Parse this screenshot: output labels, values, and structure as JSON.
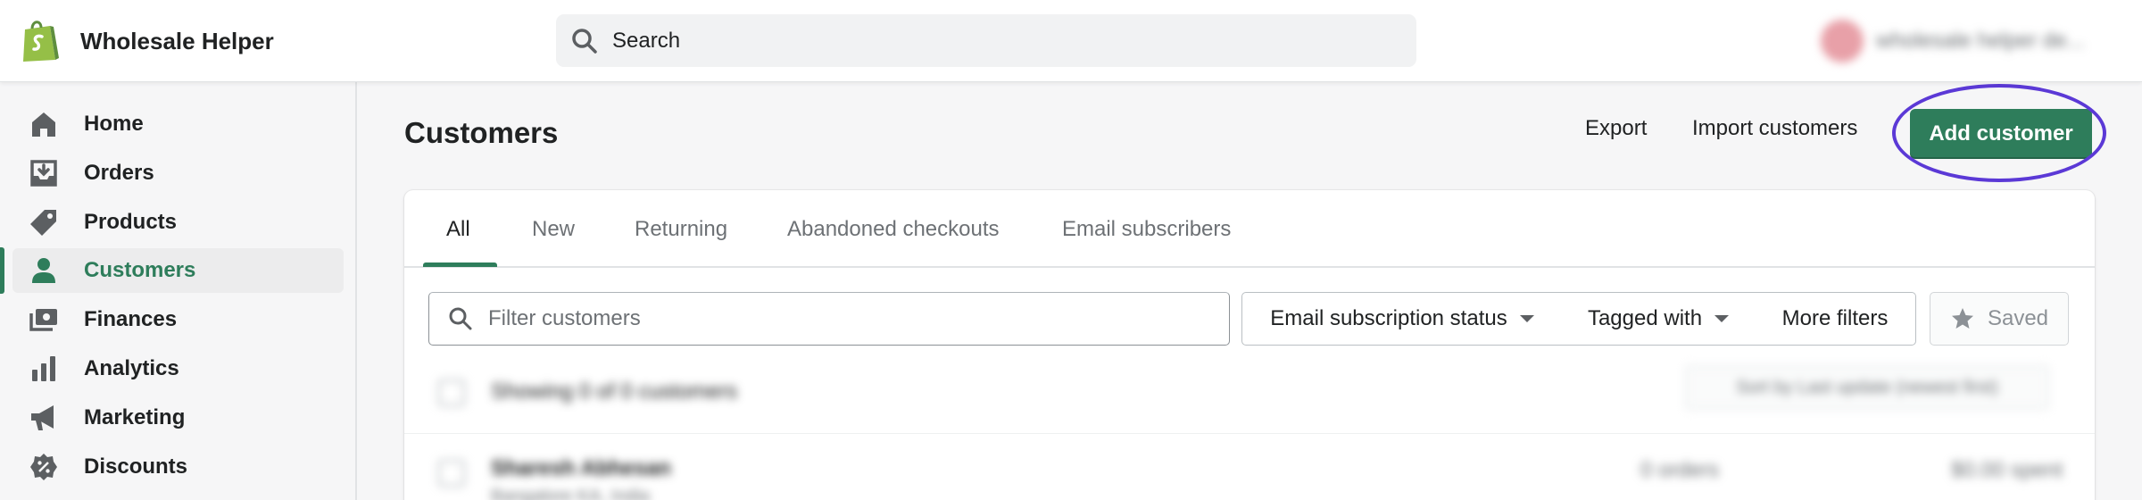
{
  "app": {
    "name": "Wholesale Helper",
    "account_name": "wholesale helper de..."
  },
  "search": {
    "placeholder": "Search"
  },
  "sidebar": {
    "items": [
      {
        "label": "Home",
        "icon": "home-icon"
      },
      {
        "label": "Orders",
        "icon": "orders-icon"
      },
      {
        "label": "Products",
        "icon": "tag-icon"
      },
      {
        "label": "Customers",
        "icon": "person-icon",
        "active": true
      },
      {
        "label": "Finances",
        "icon": "finances-icon"
      },
      {
        "label": "Analytics",
        "icon": "analytics-icon"
      },
      {
        "label": "Marketing",
        "icon": "megaphone-icon"
      },
      {
        "label": "Discounts",
        "icon": "discount-icon"
      }
    ]
  },
  "page": {
    "title": "Customers",
    "export_label": "Export",
    "import_label": "Import customers",
    "add_label": "Add customer"
  },
  "tabs": [
    {
      "label": "All",
      "active": true
    },
    {
      "label": "New"
    },
    {
      "label": "Returning"
    },
    {
      "label": "Abandoned checkouts"
    },
    {
      "label": "Email subscribers"
    }
  ],
  "filters": {
    "placeholder": "Filter customers",
    "email_status_label": "Email subscription status",
    "tagged_label": "Tagged with",
    "more_label": "More filters",
    "saved_label": "Saved"
  },
  "list": {
    "showing_text": "Showing 0 of 0 customers",
    "sort_label": "Sort by Last update (newest first)",
    "rows": [
      {
        "name": "Sharesh Abhesan",
        "location": "Bangalore KA, India",
        "orders": "0 orders",
        "spent": "$0.00 spent"
      }
    ]
  },
  "colors": {
    "accent": "#2e7d5b",
    "highlight_ring": "#5b39d6",
    "brand_logo": "#95bf47"
  }
}
